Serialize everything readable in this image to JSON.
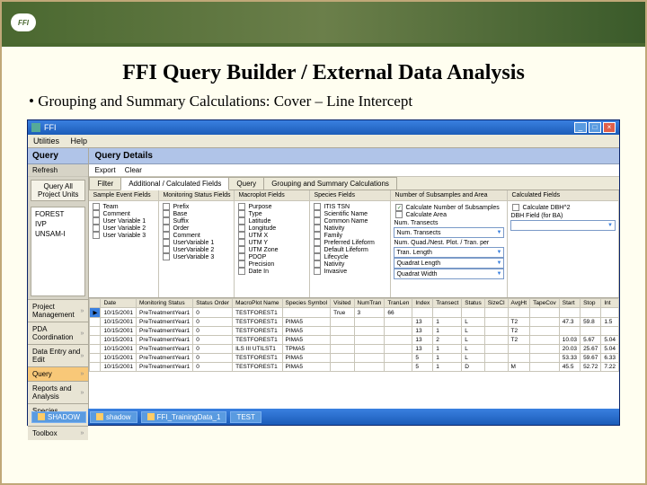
{
  "slide": {
    "title": "FFI Query Builder / External Data Analysis",
    "subtitle": "• Grouping and Summary Calculations: Cover – Line Intercept",
    "logo": "FFI"
  },
  "window": {
    "title": "FFI",
    "menu": [
      "Utilities",
      "Help"
    ]
  },
  "sidebar": {
    "header": "Query",
    "refresh": "Refresh",
    "button": "Query All Project Units",
    "units": [
      "FOREST",
      "IVP",
      "UNSAM-I"
    ],
    "nav": [
      "Project Management",
      "PDA Coordination",
      "Data Entry and Edit",
      "Query",
      "Reports and Analysis",
      "Species Management",
      "Toolbox"
    ]
  },
  "content": {
    "header": "Query Details",
    "tools": [
      "Export",
      "Clear"
    ],
    "tabs": [
      "Filter",
      "Additional / Calculated Fields",
      "Query",
      "Grouping and Summary Calculations"
    ],
    "activeTab": 1
  },
  "cols": {
    "sampleEvent": {
      "head": "Sample Event Fields",
      "items": [
        "Team",
        "Comment",
        "User Variable 1",
        "User Variable 2",
        "User Variable 3"
      ]
    },
    "monitoring": {
      "head": "Monitoring Status Fields",
      "items": [
        "Prefix",
        "Base",
        "Suffix",
        "Order",
        "Comment",
        "UserVariable 1",
        "UserVariable 2",
        "UserVariable 3"
      ]
    },
    "macroplot": {
      "head": "Macroplot Fields",
      "items": [
        "Purpose",
        "Type",
        "Latitude",
        "Longitude",
        "UTM X",
        "UTM Y",
        "UTM Zone",
        "PDOP",
        "Precision",
        "Date In"
      ]
    },
    "species": {
      "head": "Species Fields",
      "items": [
        "ITIS TSN",
        "Scientific Name",
        "Common Name",
        "Nativity",
        "Family",
        "Preferred Lifeform",
        "Default Lifeform",
        "Lifecycle",
        "Nativity",
        "Invasive"
      ]
    },
    "subsamples": {
      "head": "Number of Subsamples and Area",
      "calcNum": "Calculate Number of Subsamples",
      "calcArea": "Calculate Area",
      "labels": [
        "Num. Transects",
        "Num. Transects",
        "Num. Quad./Nest. Plot. / Tran. per",
        "Tran. Length",
        "Quadrat Length",
        "Quadrat Width"
      ]
    },
    "calcFields": {
      "head": "Calculated Fields",
      "item": "Calculate DBH^2",
      "lbl": "DBH Field (for BA)"
    }
  },
  "grid": {
    "headers": [
      "",
      "Date",
      "Monitoring Status",
      "Status Order",
      "MacroPlot Name",
      "Species Symbol",
      "Visited",
      "NumTran",
      "TranLen",
      "Index",
      "Transect",
      "Status",
      "SizeCl",
      "AvgHt",
      "TapeCov",
      "Start",
      "Stop",
      "Int"
    ],
    "rows": [
      [
        "▶",
        "10/15/2001",
        "PreTreatmentYear1",
        "0",
        "TESTFOREST1",
        "",
        "True",
        "3",
        "66",
        "",
        "",
        "",
        "",
        "",
        "",
        "",
        "",
        ""
      ],
      [
        "",
        "10/15/2001",
        "PreTreatmentYear1",
        "0",
        "TESTFOREST1",
        "PIMA5",
        "",
        "",
        "",
        "13",
        "1",
        "L",
        "",
        "T2",
        "",
        "47.3",
        "59.8",
        "1.5"
      ],
      [
        "",
        "10/15/2001",
        "PreTreatmentYear1",
        "0",
        "TESTFOREST1",
        "PIMA5",
        "",
        "",
        "",
        "13",
        "1",
        "L",
        "",
        "T2",
        "",
        "",
        "",
        ""
      ],
      [
        "",
        "10/15/2001",
        "PreTreatmentYear1",
        "0",
        "TESTFOREST1",
        "PIMA5",
        "",
        "",
        "",
        "13",
        "2",
        "L",
        "",
        "T2",
        "",
        "10.03",
        "5.67",
        "5.04"
      ],
      [
        "",
        "10/15/2001",
        "PreTreatmentYear1",
        "0",
        "ILS III UTILST1",
        "TPMA5",
        "",
        "",
        "",
        "13",
        "1",
        "L",
        "",
        "",
        "",
        "20.03",
        "25.67",
        "5.04"
      ],
      [
        "",
        "10/15/2001",
        "PreTreatmentYear1",
        "0",
        "TESTFOREST1",
        "PIMA5",
        "",
        "",
        "",
        "5",
        "1",
        "L",
        "",
        "",
        "",
        "53.33",
        "59.67",
        "6.33"
      ],
      [
        "",
        "10/15/2001",
        "PreTreatmentYear1",
        "0",
        "TESTFOREST1",
        "PIMA5",
        "",
        "",
        "",
        "5",
        "1",
        "D",
        "",
        "M",
        "",
        "45.5",
        "52.72",
        "7.22"
      ]
    ]
  },
  "taskbar": {
    "items": [
      "SHADOW",
      "shadow",
      "FFI_TrainingData_1",
      "TEST"
    ]
  }
}
